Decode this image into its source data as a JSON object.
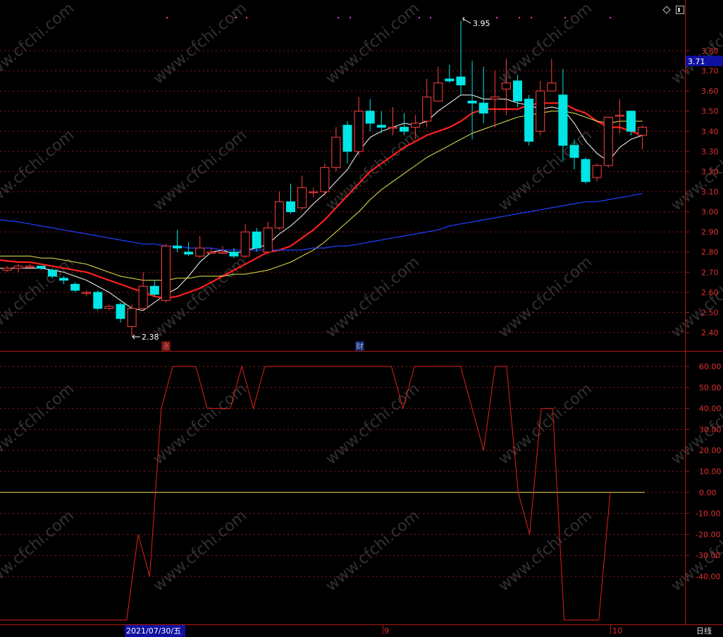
{
  "colors": {
    "up": "#ff4040",
    "down": "#00e5e5",
    "ma5": "#ffffff",
    "ma10": "#ff2020",
    "ma20": "#e8e850",
    "ma60": "#2040ff",
    "grid": "#8a1a1a",
    "osc": "#e02020",
    "zero": "#e8e850"
  },
  "watermark": "www.cfchi.com",
  "price_badge": "3.71",
  "high_label": "3.95",
  "low_label": "2.38",
  "markers": {
    "zhang": "涨",
    "cai": "财"
  },
  "x_labels": {
    "date": "2021/07/30/五",
    "m9": "9",
    "m10": "10",
    "period": "日线"
  },
  "chart_data": [
    {
      "type": "candlestick",
      "yticks": [
        "3.80",
        "3.70",
        "3.60",
        "3.50",
        "3.40",
        "3.30",
        "3.20",
        "3.10",
        "3.00",
        "2.90",
        "2.80",
        "2.70",
        "2.60",
        "2.50",
        "2.40"
      ],
      "ylim": [
        2.355,
        3.98
      ],
      "candles": [
        [
          2.71,
          2.72,
          2.73,
          2.7
        ],
        [
          2.72,
          2.73,
          2.74,
          2.7
        ],
        [
          2.73,
          2.73,
          2.74,
          2.72
        ],
        [
          2.73,
          2.72,
          2.73,
          2.71
        ],
        [
          2.71,
          2.68,
          2.72,
          2.67
        ],
        [
          2.67,
          2.66,
          2.68,
          2.64
        ],
        [
          2.64,
          2.61,
          2.65,
          2.6
        ],
        [
          2.6,
          2.6,
          2.61,
          2.58
        ],
        [
          2.6,
          2.52,
          2.61,
          2.51
        ],
        [
          2.52,
          2.53,
          2.54,
          2.51
        ],
        [
          2.54,
          2.47,
          2.55,
          2.45
        ],
        [
          2.43,
          2.52,
          2.54,
          2.38
        ],
        [
          2.52,
          2.63,
          2.7,
          2.51
        ],
        [
          2.63,
          2.59,
          2.66,
          2.58
        ],
        [
          2.56,
          2.83,
          2.84,
          2.55
        ],
        [
          2.83,
          2.82,
          2.91,
          2.8
        ],
        [
          2.8,
          2.79,
          2.85,
          2.78
        ],
        [
          2.78,
          2.82,
          2.88,
          2.77
        ],
        [
          2.8,
          2.8,
          2.82,
          2.79
        ],
        [
          2.8,
          2.8,
          2.83,
          2.79
        ],
        [
          2.8,
          2.78,
          2.82,
          2.77
        ],
        [
          2.78,
          2.9,
          2.94,
          2.77
        ],
        [
          2.9,
          2.82,
          2.92,
          2.8
        ],
        [
          2.8,
          2.92,
          2.95,
          2.79
        ],
        [
          2.92,
          3.05,
          3.1,
          2.91
        ],
        [
          3.05,
          3.0,
          3.14,
          2.99
        ],
        [
          3.02,
          3.12,
          3.18,
          3.01
        ],
        [
          3.1,
          3.1,
          3.12,
          3.07
        ],
        [
          3.1,
          3.22,
          3.24,
          3.08
        ],
        [
          3.22,
          3.37,
          3.42,
          3.2
        ],
        [
          3.43,
          3.3,
          3.45,
          3.24
        ],
        [
          3.3,
          3.5,
          3.57,
          3.28
        ],
        [
          3.5,
          3.44,
          3.56,
          3.4
        ],
        [
          3.43,
          3.42,
          3.5,
          3.39
        ],
        [
          3.42,
          3.42,
          3.52,
          3.38
        ],
        [
          3.42,
          3.4,
          3.49,
          3.38
        ],
        [
          3.42,
          3.44,
          3.48,
          3.36
        ],
        [
          3.45,
          3.57,
          3.66,
          3.42
        ],
        [
          3.55,
          3.64,
          3.72,
          3.56
        ],
        [
          3.66,
          3.65,
          3.73,
          3.64
        ],
        [
          3.67,
          3.63,
          3.95,
          3.58
        ],
        [
          3.55,
          3.54,
          3.75,
          3.36
        ],
        [
          3.54,
          3.49,
          3.72,
          3.44
        ],
        [
          3.56,
          3.57,
          3.7,
          3.42
        ],
        [
          3.61,
          3.64,
          3.76,
          3.48
        ],
        [
          3.65,
          3.55,
          3.68,
          3.52
        ],
        [
          3.56,
          3.35,
          3.58,
          3.33
        ],
        [
          3.4,
          3.6,
          3.65,
          3.38
        ],
        [
          3.6,
          3.64,
          3.76,
          3.6
        ],
        [
          3.58,
          3.33,
          3.71,
          3.25
        ],
        [
          3.33,
          3.27,
          3.36,
          3.21
        ],
        [
          3.26,
          3.15,
          3.27,
          3.14
        ],
        [
          3.17,
          3.23,
          3.24,
          3.15
        ],
        [
          3.23,
          3.47,
          3.47,
          3.22
        ],
        [
          3.48,
          3.48,
          3.56,
          3.39
        ],
        [
          3.5,
          3.4,
          3.5,
          3.38
        ],
        [
          3.38,
          3.42,
          3.43,
          3.31
        ]
      ],
      "series": [
        {
          "name": "MA5",
          "values": [
            2.72,
            2.72,
            2.72,
            2.72,
            2.71,
            2.7,
            2.68,
            2.66,
            2.63,
            2.6,
            2.56,
            2.52,
            2.51,
            2.55,
            2.59,
            2.62,
            2.68,
            2.75,
            2.8,
            2.81,
            2.79,
            2.81,
            2.82,
            2.84,
            2.89,
            2.93,
            2.98,
            3.04,
            3.09,
            3.15,
            3.21,
            3.3,
            3.37,
            3.4,
            3.42,
            3.44,
            3.43,
            3.45,
            3.5,
            3.54,
            3.58,
            3.58,
            3.56,
            3.56,
            3.56,
            3.54,
            3.53,
            3.51,
            3.52,
            3.51,
            3.44,
            3.35,
            3.29,
            3.25,
            3.32,
            3.36,
            3.38
          ]
        },
        {
          "name": "MA10",
          "values": [
            2.76,
            2.75,
            2.75,
            2.74,
            2.73,
            2.72,
            2.71,
            2.7,
            2.68,
            2.66,
            2.64,
            2.62,
            2.6,
            2.58,
            2.57,
            2.58,
            2.6,
            2.62,
            2.65,
            2.68,
            2.71,
            2.74,
            2.77,
            2.8,
            2.81,
            2.83,
            2.87,
            2.91,
            2.96,
            3.02,
            3.08,
            3.14,
            3.2,
            3.24,
            3.28,
            3.32,
            3.35,
            3.38,
            3.4,
            3.42,
            3.45,
            3.49,
            3.51,
            3.51,
            3.51,
            3.51,
            3.53,
            3.54,
            3.54,
            3.54,
            3.51,
            3.49,
            3.45,
            3.42,
            3.42,
            3.4,
            3.38
          ]
        },
        {
          "name": "MA20",
          "values": [
            2.78,
            2.78,
            2.78,
            2.77,
            2.77,
            2.76,
            2.75,
            2.74,
            2.72,
            2.7,
            2.68,
            2.67,
            2.66,
            2.66,
            2.66,
            2.67,
            2.67,
            2.68,
            2.68,
            2.68,
            2.69,
            2.69,
            2.7,
            2.71,
            2.73,
            2.75,
            2.78,
            2.81,
            2.85,
            2.9,
            2.95,
            3.0,
            3.06,
            3.11,
            3.15,
            3.19,
            3.23,
            3.27,
            3.3,
            3.33,
            3.36,
            3.39,
            3.41,
            3.43,
            3.45,
            3.47,
            3.48,
            3.49,
            3.5,
            3.5,
            3.49,
            3.47,
            3.45,
            3.44,
            3.45,
            3.45,
            3.45
          ]
        },
        {
          "name": "MA60",
          "values": [
            2.96,
            2.95,
            2.94,
            2.93,
            2.92,
            2.91,
            2.9,
            2.89,
            2.88,
            2.87,
            2.86,
            2.85,
            2.84,
            2.84,
            2.83,
            2.83,
            2.82,
            2.82,
            2.82,
            2.81,
            2.81,
            2.81,
            2.81,
            2.81,
            2.81,
            2.81,
            2.81,
            2.82,
            2.82,
            2.83,
            2.83,
            2.84,
            2.85,
            2.86,
            2.87,
            2.88,
            2.89,
            2.9,
            2.91,
            2.93,
            2.94,
            2.95,
            2.96,
            2.97,
            2.98,
            2.99,
            3.0,
            3.01,
            3.02,
            3.03,
            3.04,
            3.05,
            3.05,
            3.06,
            3.07,
            3.08,
            3.09
          ]
        }
      ]
    },
    {
      "type": "line",
      "yticks": [
        "60.00",
        "50.00",
        "40.00",
        "30.00",
        "20.00",
        "10.00",
        "0.00",
        "-10.00",
        "-20.00",
        "-30.00",
        "-40.00"
      ],
      "ylim": [
        -50,
        62
      ],
      "baseline": 0,
      "values": [
        -60,
        -60,
        -60,
        -60,
        -60,
        -60,
        -60,
        -60,
        -60,
        -60,
        -60,
        -60,
        -20,
        -40,
        40,
        60,
        60,
        60,
        40,
        40,
        40,
        60,
        40,
        60,
        60,
        60,
        60,
        60,
        60,
        60,
        60,
        60,
        60,
        60,
        60,
        40,
        60,
        60,
        60,
        60,
        60,
        40,
        20,
        60,
        60,
        0,
        -20,
        40,
        40,
        -60,
        -60,
        -60,
        -60,
        0
      ]
    }
  ]
}
